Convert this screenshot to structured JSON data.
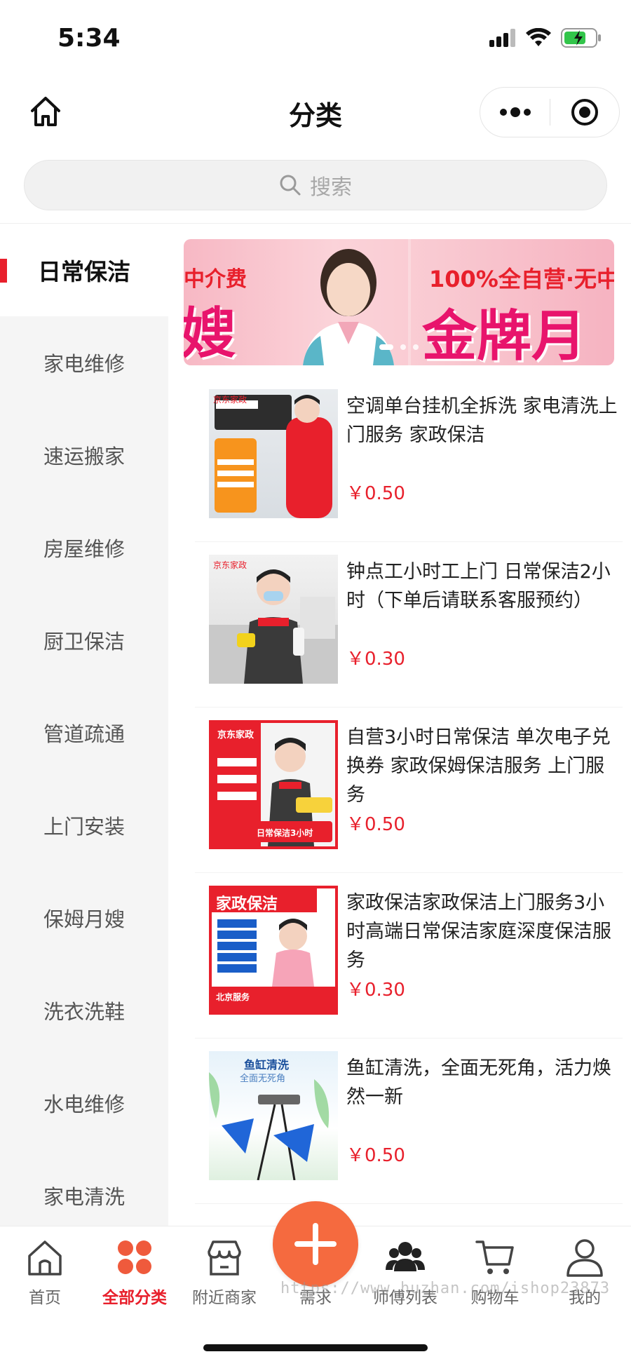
{
  "status_bar": {
    "time": "5:34"
  },
  "header": {
    "title": "分类"
  },
  "search": {
    "placeholder": "搜索"
  },
  "sidebar": {
    "items": [
      {
        "label": "日常保洁",
        "active": true
      },
      {
        "label": "家电维修"
      },
      {
        "label": "速运搬家"
      },
      {
        "label": "房屋维修"
      },
      {
        "label": "厨卫保洁"
      },
      {
        "label": "管道疏通"
      },
      {
        "label": "上门安装"
      },
      {
        "label": "保姆月嫂"
      },
      {
        "label": "洗衣洗鞋"
      },
      {
        "label": "水电维修"
      },
      {
        "label": "家电清洗"
      }
    ]
  },
  "banner": {
    "left_top": "中介费",
    "left_big": "嫂",
    "right_top": "100%全自营·无中",
    "right_big": "金牌月"
  },
  "products": [
    {
      "title": "空调单台挂机全拆洗 家电清洗上门服务 家政保洁",
      "price": "￥0.50",
      "thumb_text": "京东家政"
    },
    {
      "title": "钟点工小时工上门 日常保洁2小时（下单后请联系客服预约）",
      "price": "￥0.30",
      "thumb_text": "京东家政"
    },
    {
      "title": "自营3小时日常保洁 单次电子兑换券 家政保姆保洁服务 上门服务",
      "price": "￥0.50",
      "thumb_text": "京东家政",
      "thumb_badge": "日常保洁3小时"
    },
    {
      "title": "家政保洁家政保洁上门服务3小时高端日常保洁家庭深度保洁服务",
      "price": "￥0.30",
      "thumb_text": "家政保洁",
      "thumb_sub": "北京服务"
    },
    {
      "title": "鱼缸清洗，全面无死角，活力焕然一新",
      "price": "￥0.50",
      "thumb_text": "鱼缸清洗",
      "thumb_sub": "全面无死角"
    }
  ],
  "tabbar": {
    "tabs": [
      {
        "label": "首页"
      },
      {
        "label": "全部分类",
        "active": true
      },
      {
        "label": "附近商家"
      },
      {
        "label": "需求"
      },
      {
        "label": "师傅列表"
      },
      {
        "label": "购物车"
      },
      {
        "label": "我的"
      }
    ],
    "watermark": "https://www.huzhan.com/ishop23873"
  },
  "colors": {
    "accent": "#e8202c",
    "fab": "#f56a3f",
    "sidebar_bg": "#f5f5f5"
  },
  "icons": [
    "home-icon",
    "more-icon",
    "close-circle-icon",
    "search-icon",
    "grid-icon",
    "store-icon",
    "plus-icon",
    "users-icon",
    "cart-icon",
    "user-icon",
    "signal-icon",
    "wifi-icon",
    "battery-icon"
  ]
}
